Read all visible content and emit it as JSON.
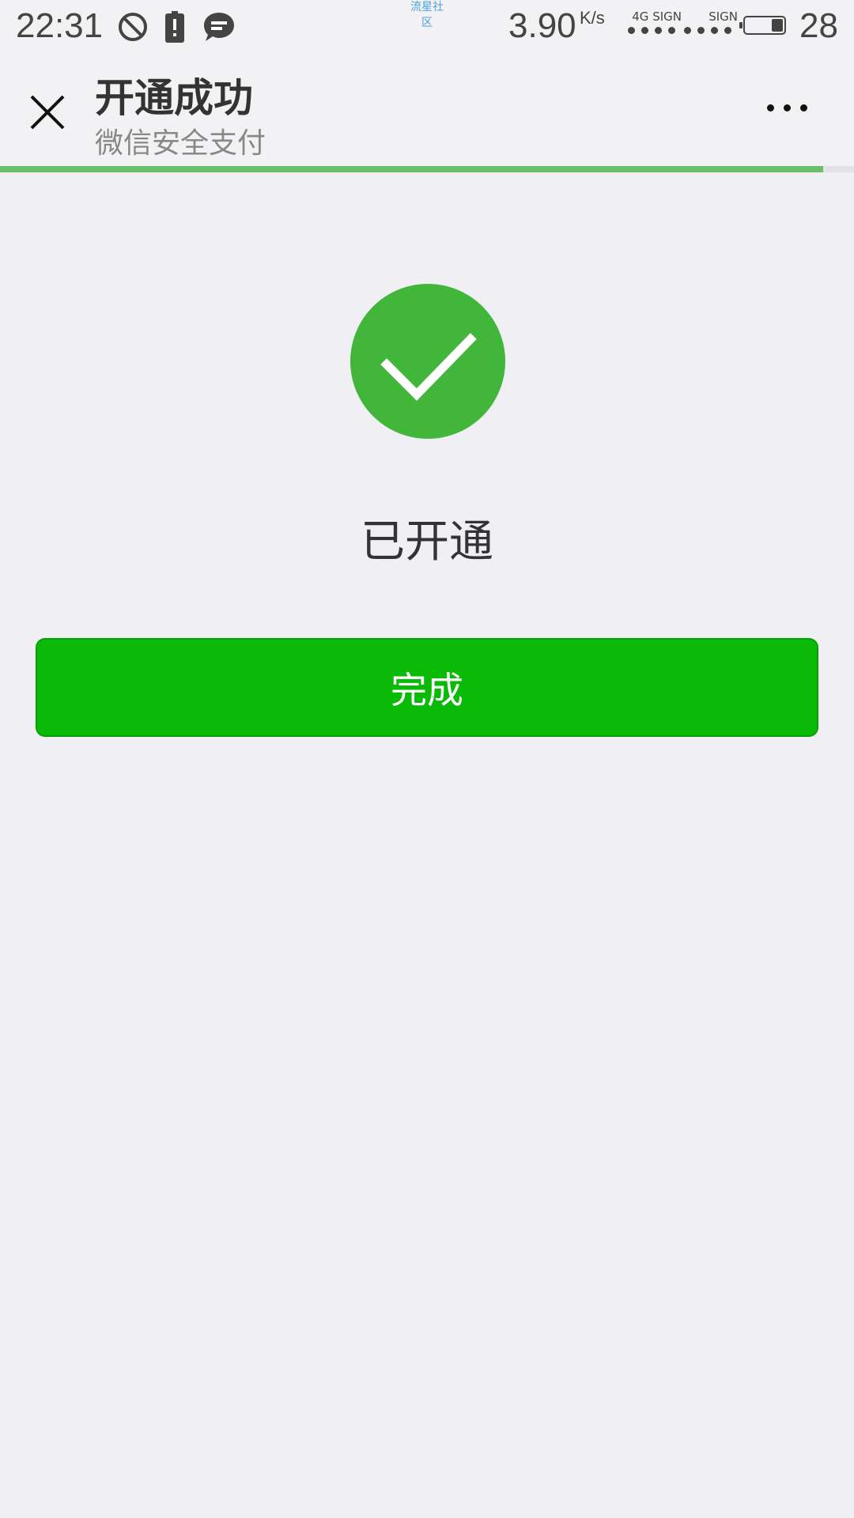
{
  "status_bar": {
    "time": "22:31",
    "watermark": "流星社区",
    "speed": "3.90",
    "speed_unit": "K/s",
    "signal_1_label": "4G SIGN",
    "signal_2_label": "SIGN",
    "battery_level": "28",
    "icons": [
      "do-not-disturb-icon",
      "battery-alert-icon",
      "message-icon"
    ]
  },
  "header": {
    "title": "开通成功",
    "subtitle": "微信安全支付",
    "close_icon": "close-icon",
    "more_icon": "more-icon",
    "load_progress": 0.964
  },
  "main": {
    "status_text": "已开通",
    "done_label": "完成",
    "success_icon": "check-circle-icon"
  },
  "colors": {
    "accent_green": "#09bb07",
    "success_green": "#41b63a",
    "progress_green": "#6abf69",
    "background": "#efeff4"
  }
}
